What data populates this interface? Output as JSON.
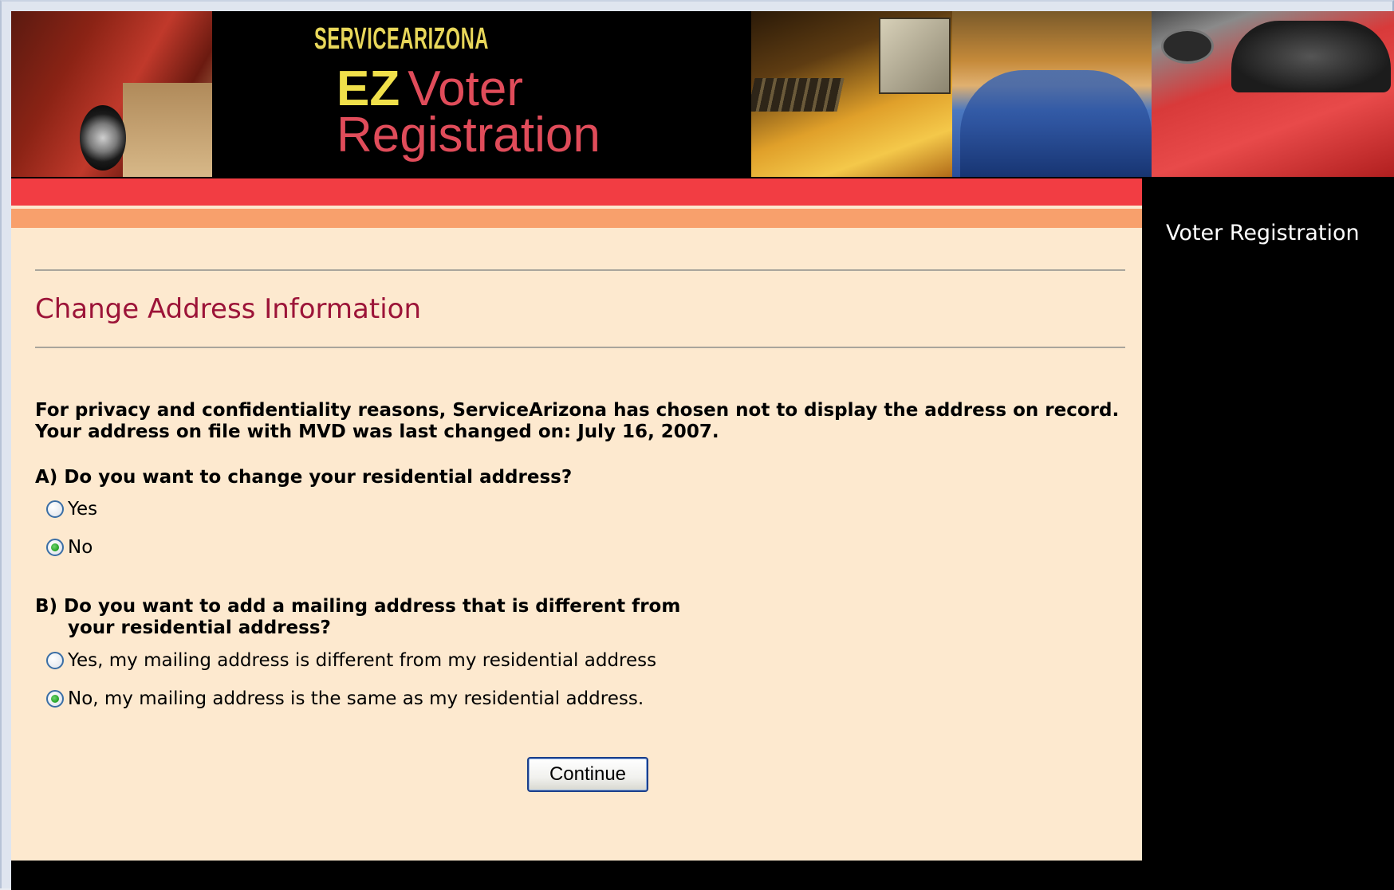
{
  "banner": {
    "brand": "SERVICEARIZONA",
    "title_ez": "EZ",
    "title_word1": "Voter",
    "title_word2": "Registration"
  },
  "sidebar": {
    "link_label": "Voter Registration"
  },
  "main": {
    "page_title": "Change Address Information",
    "privacy_line1": "For privacy and confidentiality reasons, ServiceArizona has chosen not to display the address on record.",
    "privacy_line2": "Your address on file with MVD was last changed on: July 16, 2007.",
    "question_a": {
      "text": "A) Do you want to change your residential address?",
      "options": [
        {
          "label": "Yes",
          "selected": false
        },
        {
          "label": "No",
          "selected": true
        }
      ]
    },
    "question_b": {
      "text_line1": "B) Do you want to add a mailing address that is different from",
      "text_line2": "your residential address?",
      "options": [
        {
          "label": "Yes, my mailing address is different from my residential address",
          "selected": false
        },
        {
          "label": "No, my mailing address is the same as my residential address.",
          "selected": true
        }
      ]
    },
    "continue_label": "Continue"
  },
  "colors": {
    "title_color": "#9c1438",
    "content_background": "#fde9cf",
    "stripe_red": "#f23d43",
    "stripe_orange": "#f8a06c",
    "radio_selected": "#21a121"
  }
}
